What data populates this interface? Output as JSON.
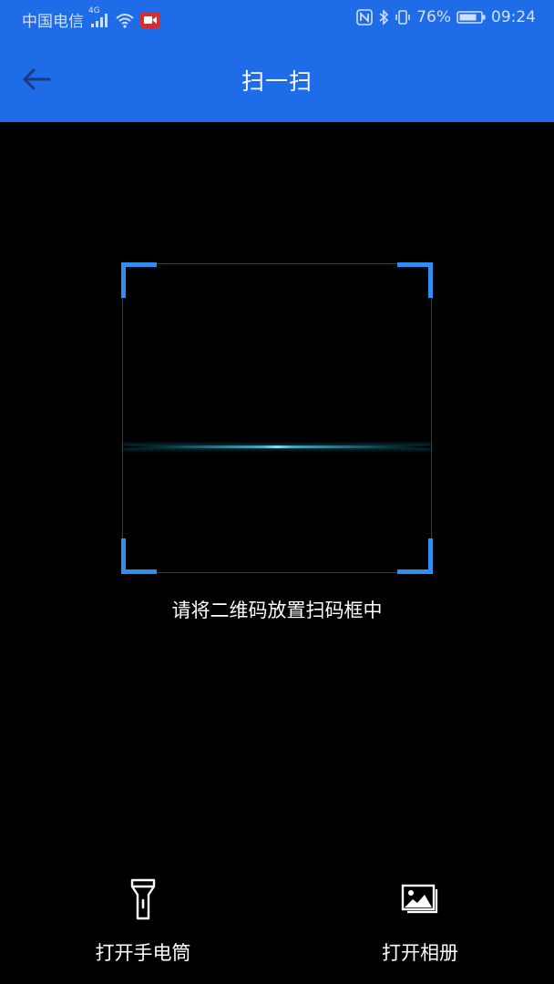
{
  "status_bar": {
    "carrier": "中国电信",
    "network": "4G",
    "battery": "76%",
    "time": "09:24",
    "icons": [
      "signal-icon",
      "wifi-icon",
      "screen-record-icon",
      "nfc-icon",
      "bluetooth-icon",
      "vibrate-icon",
      "battery-icon"
    ]
  },
  "app_bar": {
    "title": "扫一扫",
    "back_icon": "arrow-left-icon"
  },
  "scanner": {
    "hint": "请将二维码放置扫码框中",
    "frame_color": "#2f8ff0",
    "line_color": "#28c8eb"
  },
  "actions": {
    "flashlight": {
      "label": "打开手电筒",
      "icon": "flashlight-icon"
    },
    "album": {
      "label": "打开相册",
      "icon": "photo-album-icon"
    }
  },
  "colors": {
    "header": "#1f6ce8",
    "background": "#000000"
  }
}
